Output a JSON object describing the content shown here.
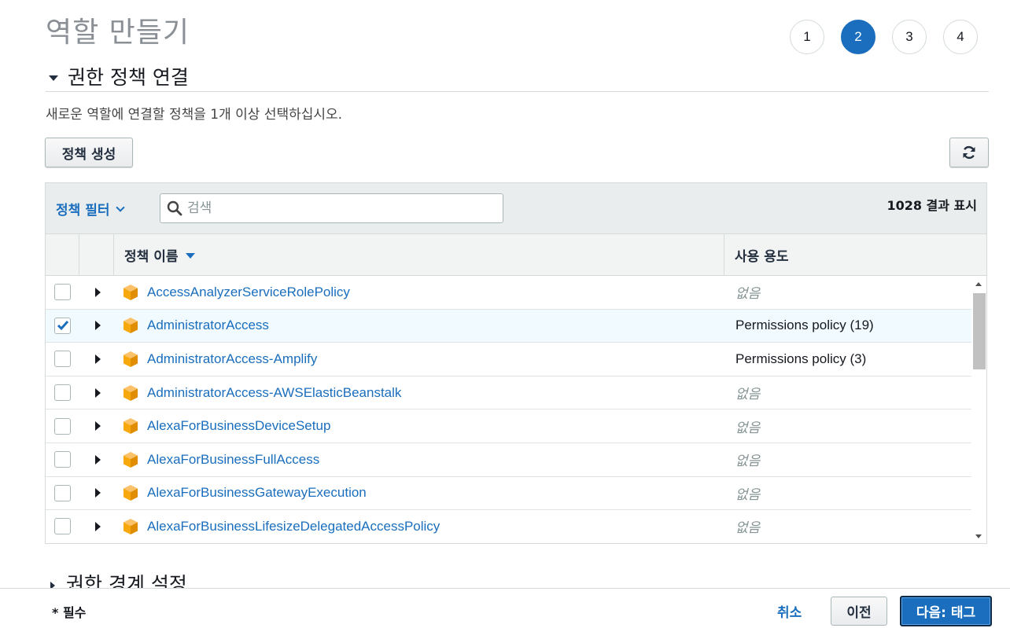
{
  "page": {
    "title": "역할 만들기"
  },
  "steps": [
    {
      "label": "1",
      "active": false
    },
    {
      "label": "2",
      "active": true
    },
    {
      "label": "3",
      "active": false
    },
    {
      "label": "4",
      "active": false
    }
  ],
  "section": {
    "title": "권한 정책 연결",
    "description": "새로운 역할에 연결할 정책을 1개 이상 선택하십시오.",
    "create_button": "정책 생성",
    "refresh_icon": "refresh-icon"
  },
  "filter": {
    "label": "정책 필터",
    "search_placeholder": "검색",
    "result_count": "1028 결과 표시"
  },
  "table": {
    "columns": {
      "name": "정책 이름",
      "usage": "사용 용도"
    },
    "rows": [
      {
        "name": "AccessAnalyzerServiceRolePolicy",
        "usage": "없음",
        "checked": false
      },
      {
        "name": "AdministratorAccess",
        "usage": "Permissions policy (19)",
        "checked": true
      },
      {
        "name": "AdministratorAccess-Amplify",
        "usage": "Permissions policy (3)",
        "checked": false
      },
      {
        "name": "AdministratorAccess-AWSElasticBeanstalk",
        "usage": "없음",
        "checked": false
      },
      {
        "name": "AlexaForBusinessDeviceSetup",
        "usage": "없음",
        "checked": false
      },
      {
        "name": "AlexaForBusinessFullAccess",
        "usage": "없음",
        "checked": false
      },
      {
        "name": "AlexaForBusinessGatewayExecution",
        "usage": "없음",
        "checked": false
      },
      {
        "name": "AlexaForBusinessLifesizeDelegatedAccessPolicy",
        "usage": "없음",
        "checked": false
      }
    ]
  },
  "section2": {
    "title": "권한 경계 설정"
  },
  "footer": {
    "required": "* 필수",
    "cancel": "취소",
    "previous": "이전",
    "next": "다음: 태그"
  },
  "colors": {
    "accent": "#1a6ebd",
    "policy_icon": "#f7a80d",
    "selected_row": "#f1faff"
  }
}
